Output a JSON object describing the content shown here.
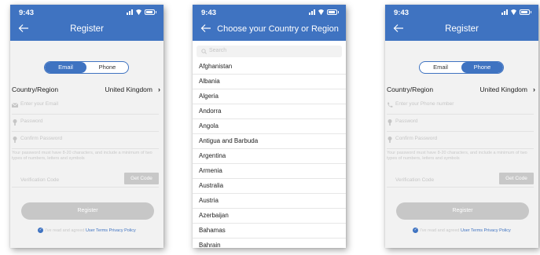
{
  "status": {
    "time": "9:43"
  },
  "screen1": {
    "title": "Register",
    "tabs": [
      "Email",
      "Phone"
    ],
    "country_label": "Country/Region",
    "country_value": "United Kingdom",
    "fields": {
      "email_placeholder": "Enter your Email",
      "password_placeholder": "Password",
      "confirm_placeholder": "Confirm Password"
    },
    "hint": "Your password must have 8-20 characters, and include a minimum of two types of numbers, letters and symbols",
    "verification_placeholder": "Verification Code",
    "get_code": "Get Code",
    "register": "Register",
    "agree_text": "I've read and agreed",
    "terms_link": "User Terms",
    "privacy_link": "Privacy Policy"
  },
  "screen2": {
    "title": "Choose your Country or Region",
    "search_placeholder": "Search",
    "countries": [
      "Afghanistan",
      "Albania",
      "Algeria",
      "Andorra",
      "Angola",
      "Antigua and Barbuda",
      "Argentina",
      "Armenia",
      "Australia",
      "Austria",
      "Azerbaijan",
      "Bahamas",
      "Bahrain"
    ]
  },
  "screen3": {
    "title": "Register",
    "tabs": [
      "Email",
      "Phone"
    ],
    "country_label": "Country/Region",
    "country_value": "United Kingdom",
    "fields": {
      "phone_placeholder": "Enter your Phone number",
      "password_placeholder": "Password",
      "confirm_placeholder": "Confirm Password"
    },
    "hint": "Your password must have 8-20 characters, and include a minimum of two types of numbers, letters and symbols",
    "verification_placeholder": "Verification Code",
    "get_code": "Get Code",
    "register": "Register",
    "agree_text": "I've read and agreed",
    "terms_link": "User Terms",
    "privacy_link": "Privacy Policy"
  },
  "colors": {
    "accent": "#3f73c1",
    "disabled": "#c7c7c7",
    "background": "#f2f2f2"
  }
}
